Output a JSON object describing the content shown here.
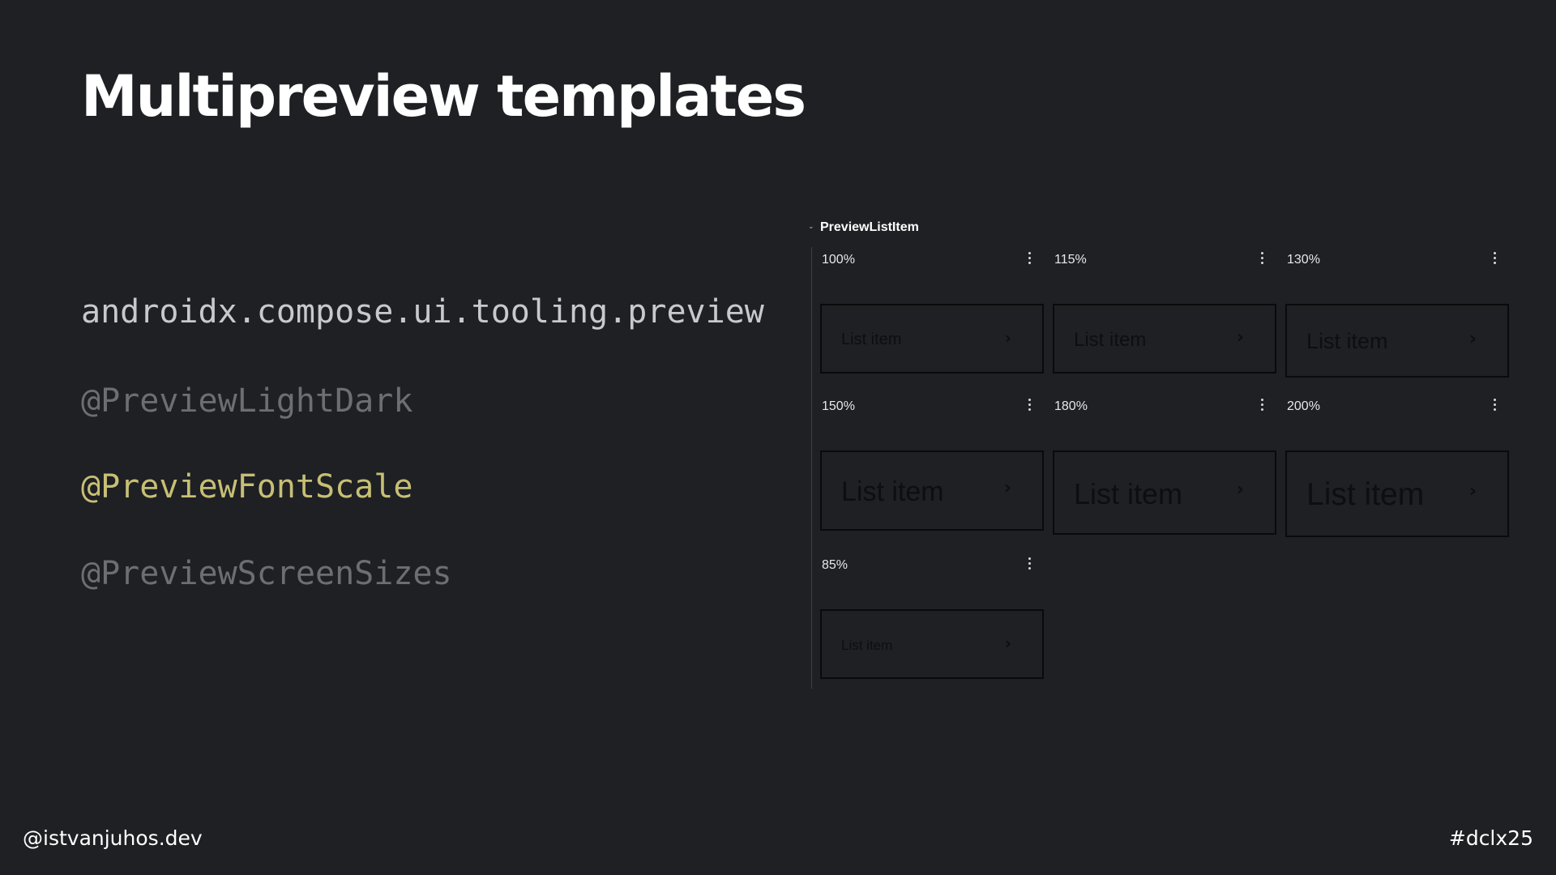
{
  "slide": {
    "title": "Multipreview templates",
    "code_lines": {
      "package": "androidx.compose.ui.tooling.preview",
      "light_dark": "@PreviewLightDark",
      "font_scale": "@PreviewFontScale",
      "screen_sizes": "@PreviewScreenSizes"
    },
    "highlight_color": "#c7bf75",
    "dim_color": "#6d6e72"
  },
  "preview_panel": {
    "group_title": "PreviewListItem",
    "group_chevron_icon": "chevron-down-icon",
    "previews": [
      {
        "scale_label": "100%",
        "item_text": "List item"
      },
      {
        "scale_label": "115%",
        "item_text": "List item"
      },
      {
        "scale_label": "130%",
        "item_text": "List item"
      },
      {
        "scale_label": "150%",
        "item_text": "List item"
      },
      {
        "scale_label": "180%",
        "item_text": "List item"
      },
      {
        "scale_label": "200%",
        "item_text": "List item"
      },
      {
        "scale_label": "85%",
        "item_text": "List item"
      }
    ],
    "menu_icon": "more-vert-icon",
    "item_chevron_icon": "chevron-right-icon"
  },
  "footer": {
    "handle": "@istvanjuhos.dev",
    "hashtag": "#dclx25"
  }
}
